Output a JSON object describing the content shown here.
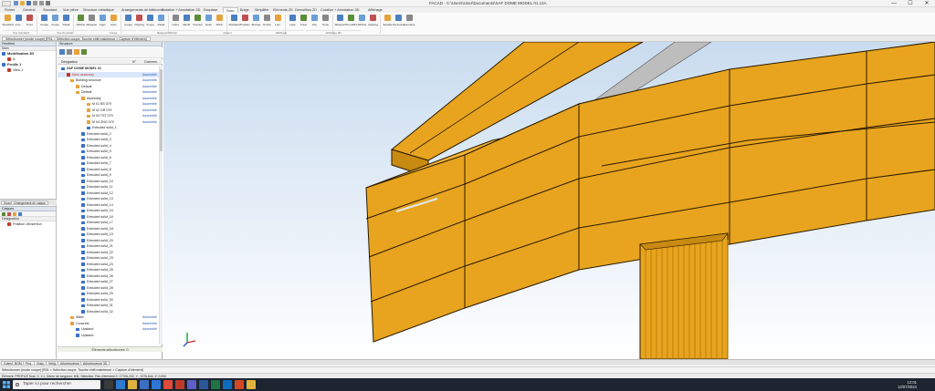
{
  "titlebar": {
    "title": "FACAD - C:\\Users\\User\\Documents\\SAF DOME MODEL 01.12A",
    "quick_access": [
      "new-icon",
      "open-icon",
      "save-icon",
      "undo-icon",
      "redo-icon",
      "print-icon"
    ],
    "minimize": "—",
    "maximize": "☐",
    "close": "✕"
  },
  "ribbon_tabs": [
    "Fichier",
    "Général",
    "Standard",
    "Vue pièce",
    "Structure métallique",
    "Arrangements de bâtiments",
    "Cotation + Annotation 2D",
    "Esquisse",
    "Scan",
    "Bulge",
    "Simplifier",
    "Eléments 2D",
    "Démolition 2D",
    "Cotation + Annotation 3D",
    "Affichage"
  ],
  "ribbon_active_tab": 8,
  "ribbon_buttons": [
    {
      "label": "Standard",
      "icon": "cube-icon",
      "color": "#e6a23c"
    },
    {
      "label": "A la...",
      "icon": "view-icon",
      "color": "#4a7fc1"
    },
    {
      "label": "Pivot",
      "icon": "pivot-icon",
      "color": "#c05050"
    },
    {
      "label": "Coupe",
      "icon": "section-icon",
      "color": "#4a7fc1"
    },
    {
      "label": "Coupe",
      "icon": "section-icon",
      "color": "#6a9fd8"
    },
    {
      "label": "Détail",
      "icon": "detail-icon",
      "color": "#4a7fc1"
    },
    {
      "label": "Afficher",
      "icon": "show-icon",
      "color": "#5b8c3a"
    },
    {
      "label": "Masquer",
      "icon": "hide-icon",
      "color": "#888888"
    },
    {
      "label": "Figer",
      "icon": "freeze-icon",
      "color": "#6a9fd8"
    },
    {
      "label": "Activ.",
      "icon": "activate-icon",
      "color": "#e6a23c"
    },
    {
      "label": "Coupe",
      "icon": "cut-icon",
      "color": "#4a7fc1"
    },
    {
      "label": "Clipping",
      "icon": "clip-icon",
      "color": "#c05050"
    },
    {
      "label": "Coupe",
      "icon": "cut-icon",
      "color": "#4a7fc1"
    },
    {
      "label": "Détail",
      "icon": "detail-icon",
      "color": "#6a9fd8"
    },
    {
      "label": "Interv.",
      "icon": "interval-icon",
      "color": "#888888"
    },
    {
      "label": "Identif.",
      "icon": "identify-icon",
      "color": "#4a7fc1"
    },
    {
      "label": "Inverser",
      "icon": "invert-icon",
      "color": "#5b8c3a"
    },
    {
      "label": "Isoler",
      "icon": "isolate-icon",
      "color": "#6a9fd8"
    },
    {
      "label": "Filtrer",
      "icon": "filter-icon",
      "color": "#e6a23c"
    },
    {
      "label": "Standard",
      "icon": "standard-icon",
      "color": "#4a7fc1"
    },
    {
      "label": "Position",
      "icon": "position-icon",
      "color": "#c05050"
    },
    {
      "label": "Bureau",
      "icon": "desk-icon",
      "color": "#6a9fd8"
    },
    {
      "label": "Ombre",
      "icon": "shadow-icon",
      "color": "#888888"
    },
    {
      "label": "Lum.",
      "icon": "light-icon",
      "color": "#e6a23c"
    },
    {
      "label": "Liste",
      "icon": "list-icon",
      "color": "#4a7fc1"
    },
    {
      "label": "Créer",
      "icon": "create-icon",
      "color": "#5b8c3a"
    },
    {
      "label": "Obj.",
      "icon": "object-icon",
      "color": "#6a9fd8"
    },
    {
      "label": "Texte",
      "icon": "text-icon",
      "color": "#888888"
    },
    {
      "label": "Masquer",
      "icon": "mask-icon",
      "color": "#4a7fc1"
    },
    {
      "label": "Tout afficher",
      "icon": "show-all-icon",
      "color": "#5b8c3a"
    },
    {
      "label": "Afficher",
      "icon": "display-icon",
      "color": "#6a9fd8"
    },
    {
      "label": "Clipping",
      "icon": "clipping-icon",
      "color": "#c05050"
    },
    {
      "label": "Echelle",
      "icon": "scale-icon",
      "color": "#e6a23c"
    },
    {
      "label": "Personnal.",
      "icon": "custom-icon",
      "color": "#4a7fc1"
    },
    {
      "label": "Domaine",
      "icon": "domain-icon",
      "color": "#888888"
    }
  ],
  "ribbon_groups": [
    "Vue standard",
    "Vue de détail",
    "Coupe",
    "Masquer/Afficher",
    "Aspect",
    "Affichage",
    "Affichage 3D"
  ],
  "doc_tab": "Sélectionner (mode coupe) [R01 > Sélection coupe, Touche shift maintenue > Capture d'élément]",
  "left_panel_1": {
    "header": "Fenêtres",
    "subheader": "Nom",
    "rows": [
      {
        "label": "Modélisation 3D",
        "bold": true,
        "color": "#3a6fc7",
        "indent": 2
      },
      {
        "label": "A",
        "bold": false,
        "color": "#c0392b",
        "indent": 8
      },
      {
        "label": "Feuille 1",
        "bold": true,
        "color": "#3a6fc7",
        "indent": 2
      },
      {
        "label": "View 1",
        "bold": false,
        "color": "#c0392b",
        "indent": 8
      }
    ]
  },
  "left_panel_tabs": [
    "Scan",
    "Changement de calque"
  ],
  "left_panel_2": {
    "header": "Calques",
    "subheader": "Désignation",
    "rows": [
      {
        "label": "Position d'insertion",
        "color": "#c0392b"
      }
    ]
  },
  "tree_panel": {
    "header": "Structure",
    "columns": [
      "Désignation",
      "N°",
      "Commen."
    ],
    "foot": "Éléments sélectionnés: 0",
    "rows": [
      {
        "label": "SAF DOME MODEL 01",
        "indent": 4,
        "icon": "#3a6fc7",
        "comment": "",
        "sel": false,
        "bold": true
      },
      {
        "label": "Main assembly",
        "indent": 10,
        "icon": "#c0392b",
        "comment": "Assemblé",
        "sel": true,
        "red": true
      },
      {
        "label": "Building structure",
        "indent": 14,
        "icon": "#e6a23c",
        "comment": "Assemblé",
        "sel": false
      },
      {
        "label": "Default",
        "indent": 20,
        "icon": "#e6a23c",
        "comment": "Assemblé",
        "sel": false
      },
      {
        "label": "Default",
        "indent": 20,
        "icon": "#e6a23c",
        "comment": "Assemblé",
        "sel": false
      },
      {
        "label": "Assembly",
        "indent": 26,
        "icon": "#e6a23c",
        "comment": "Assemblé",
        "sel": false
      },
      {
        "label": "M 01 BS 079",
        "indent": 32,
        "icon": "#e6a23c",
        "comment": "Assemblé",
        "sel": false
      },
      {
        "label": "M 02 GR 079",
        "indent": 32,
        "icon": "#e6a23c",
        "comment": "Assemblé",
        "sel": false
      },
      {
        "label": "M 03 TST 079",
        "indent": 32,
        "icon": "#e6a23c",
        "comment": "Assemblé",
        "sel": false
      },
      {
        "label": "M 04 ZNO 079",
        "indent": 32,
        "icon": "#e6a23c",
        "comment": "Assemblé",
        "sel": false
      },
      {
        "label": "Extruded solid_1",
        "indent": 32,
        "icon": "#3a6fc7",
        "comment": "",
        "sel": false
      },
      {
        "label": "Extruded solid_2",
        "indent": 26,
        "icon": "#3a6fc7",
        "comment": "",
        "sel": false
      },
      {
        "label": "Extruded solid_3",
        "indent": 26,
        "icon": "#3a6fc7",
        "comment": "",
        "sel": false
      },
      {
        "label": "Extruded solid_4",
        "indent": 26,
        "icon": "#3a6fc7",
        "comment": "",
        "sel": false
      },
      {
        "label": "Extruded solid_5",
        "indent": 26,
        "icon": "#3a6fc7",
        "comment": "",
        "sel": false
      },
      {
        "label": "Extruded solid_6",
        "indent": 26,
        "icon": "#3a6fc7",
        "comment": "",
        "sel": false
      },
      {
        "label": "Extruded solid_7",
        "indent": 26,
        "icon": "#3a6fc7",
        "comment": "",
        "sel": false
      },
      {
        "label": "Extruded solid_8",
        "indent": 26,
        "icon": "#3a6fc7",
        "comment": "",
        "sel": false
      },
      {
        "label": "Extruded solid_9",
        "indent": 26,
        "icon": "#3a6fc7",
        "comment": "",
        "sel": false
      },
      {
        "label": "Extruded solid_10",
        "indent": 26,
        "icon": "#3a6fc7",
        "comment": "",
        "sel": false
      },
      {
        "label": "Extruded solid_11",
        "indent": 26,
        "icon": "#3a6fc7",
        "comment": "",
        "sel": false
      },
      {
        "label": "Extruded solid_12",
        "indent": 26,
        "icon": "#3a6fc7",
        "comment": "",
        "sel": false
      },
      {
        "label": "Extruded solid_13",
        "indent": 26,
        "icon": "#3a6fc7",
        "comment": "",
        "sel": false
      },
      {
        "label": "Extruded solid_14",
        "indent": 26,
        "icon": "#3a6fc7",
        "comment": "",
        "sel": false
      },
      {
        "label": "Extruded solid_15",
        "indent": 26,
        "icon": "#3a6fc7",
        "comment": "",
        "sel": false
      },
      {
        "label": "Extruded solid_16",
        "indent": 26,
        "icon": "#3a6fc7",
        "comment": "",
        "sel": false
      },
      {
        "label": "Extruded solid_17",
        "indent": 26,
        "icon": "#3a6fc7",
        "comment": "",
        "sel": false
      },
      {
        "label": "Extruded solid_18",
        "indent": 26,
        "icon": "#3a6fc7",
        "comment": "",
        "sel": false
      },
      {
        "label": "Extruded solid_19",
        "indent": 26,
        "icon": "#3a6fc7",
        "comment": "",
        "sel": false
      },
      {
        "label": "Extruded solid_20",
        "indent": 26,
        "icon": "#3a6fc7",
        "comment": "",
        "sel": false
      },
      {
        "label": "Extruded solid_21",
        "indent": 26,
        "icon": "#3a6fc7",
        "comment": "",
        "sel": false
      },
      {
        "label": "Extruded solid_22",
        "indent": 26,
        "icon": "#3a6fc7",
        "comment": "",
        "sel": false
      },
      {
        "label": "Extruded solid_23",
        "indent": 26,
        "icon": "#3a6fc7",
        "comment": "",
        "sel": false
      },
      {
        "label": "Extruded solid_24",
        "indent": 26,
        "icon": "#3a6fc7",
        "comment": "",
        "sel": false
      },
      {
        "label": "Extruded solid_25",
        "indent": 26,
        "icon": "#3a6fc7",
        "comment": "",
        "sel": false
      },
      {
        "label": "Extruded solid_26",
        "indent": 26,
        "icon": "#3a6fc7",
        "comment": "",
        "sel": false
      },
      {
        "label": "Extruded solid_27",
        "indent": 26,
        "icon": "#3a6fc7",
        "comment": "",
        "sel": false
      },
      {
        "label": "Extruded solid_28",
        "indent": 26,
        "icon": "#3a6fc7",
        "comment": "",
        "sel": false
      },
      {
        "label": "Extruded solid_29",
        "indent": 26,
        "icon": "#3a6fc7",
        "comment": "",
        "sel": false
      },
      {
        "label": "Extruded solid_30",
        "indent": 26,
        "icon": "#3a6fc7",
        "comment": "",
        "sel": false
      },
      {
        "label": "Extruded solid_31",
        "indent": 26,
        "icon": "#3a6fc7",
        "comment": "",
        "sel": false
      },
      {
        "label": "Extruded solid_32",
        "indent": 26,
        "icon": "#3a6fc7",
        "comment": "",
        "sel": false
      },
      {
        "label": "Walls",
        "indent": 14,
        "icon": "#e6a23c",
        "comment": "Assemblé",
        "sel": false
      },
      {
        "label": "Concrete",
        "indent": 14,
        "icon": "#e6a23c",
        "comment": "Assemblé",
        "sel": false
      },
      {
        "label": "Upstand",
        "indent": 20,
        "icon": "#3a6fc7",
        "comment": "Assemblé",
        "sel": false
      },
      {
        "label": "Upstand",
        "indent": 20,
        "icon": "#3a6fc7",
        "comment": "",
        "sel": false
      }
    ]
  },
  "bottom_tabs": [
    "Cotes",
    "BOM",
    "Proj.",
    "Grap..",
    "Vérig..",
    "Arborescence 2D",
    "Arborescence 3D"
  ],
  "command_line": "Sélectionner (mode coupe) [R01 > Sélection coupe, Touche shift maintenue > Capture d'élément]",
  "status_line": "Elément: PROFILÉ Scal. X: 1:1, Dème de longueur: 606, Sélection: Pas d'élément     X: 17706,232, Y: -3276,844, Z: 0,000",
  "taskbar": {
    "search_placeholder": "Taper ici pour rechercher",
    "time": "12:01",
    "date": "12/07/2024",
    "apps": [
      "task-view-icon",
      "edge-icon",
      "explorer-icon",
      "store-icon",
      "mail-icon",
      "chrome-icon",
      "facad-icon",
      "teams-icon",
      "word-icon",
      "excel-icon",
      "outlook-icon",
      "pdf-icon",
      "folder-icon"
    ]
  },
  "viewport": {
    "background": "#ffffff",
    "wood": "#e8a41e",
    "wood_dark": "#c88a10",
    "wood_light": "#f2b432",
    "column": "#e8a41e"
  }
}
